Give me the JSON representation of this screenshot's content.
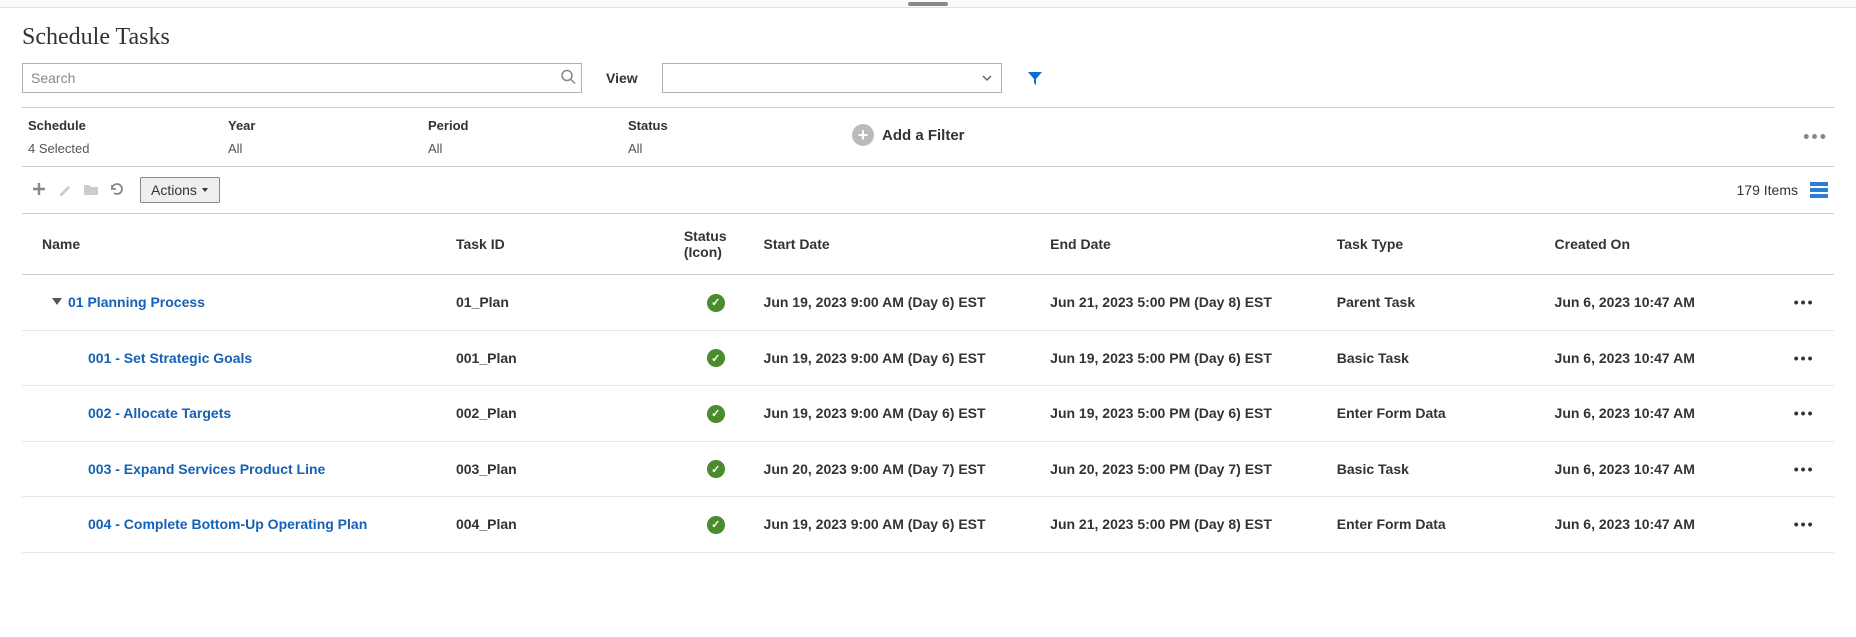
{
  "page_title": "Schedule Tasks",
  "search": {
    "placeholder": "Search"
  },
  "view_label": "View",
  "filters": [
    {
      "label": "Schedule",
      "value": "4 Selected"
    },
    {
      "label": "Year",
      "value": "All"
    },
    {
      "label": "Period",
      "value": "All"
    },
    {
      "label": "Status",
      "value": "All"
    }
  ],
  "add_filter_label": "Add a Filter",
  "toolbar": {
    "actions_label": "Actions",
    "item_count_label": "179 Items"
  },
  "columns": {
    "name": "Name",
    "task_id": "Task ID",
    "status_icon": "Status (Icon)",
    "start_date": "Start Date",
    "end_date": "End Date",
    "task_type": "Task Type",
    "created_on": "Created On"
  },
  "rows": [
    {
      "level": 1,
      "expandable": true,
      "name": "01 Planning Process",
      "task_id": "01_Plan",
      "status": "ok",
      "start_date": "Jun 19, 2023 9:00 AM (Day 6) EST",
      "end_date": "Jun 21, 2023 5:00 PM (Day 8) EST",
      "task_type": "Parent Task",
      "created_on": "Jun 6, 2023 10:47 AM"
    },
    {
      "level": 2,
      "expandable": false,
      "name": "001 - Set Strategic Goals",
      "task_id": "001_Plan",
      "status": "ok",
      "start_date": "Jun 19, 2023 9:00 AM (Day 6) EST",
      "end_date": "Jun 19, 2023 5:00 PM (Day 6) EST",
      "task_type": "Basic Task",
      "created_on": "Jun 6, 2023 10:47 AM"
    },
    {
      "level": 2,
      "expandable": false,
      "name": "002 - Allocate Targets",
      "task_id": "002_Plan",
      "status": "ok",
      "start_date": "Jun 19, 2023 9:00 AM (Day 6) EST",
      "end_date": "Jun 19, 2023 5:00 PM (Day 6) EST",
      "task_type": "Enter Form Data",
      "created_on": "Jun 6, 2023 10:47 AM"
    },
    {
      "level": 2,
      "expandable": false,
      "name": "003 - Expand Services Product Line",
      "task_id": "003_Plan",
      "status": "ok",
      "start_date": "Jun 20, 2023 9:00 AM (Day 7) EST",
      "end_date": "Jun 20, 2023 5:00 PM (Day 7) EST",
      "task_type": "Basic Task",
      "created_on": "Jun 6, 2023 10:47 AM"
    },
    {
      "level": 2,
      "expandable": false,
      "name": "004 - Complete Bottom-Up Operating Plan",
      "task_id": "004_Plan",
      "status": "ok",
      "start_date": "Jun 19, 2023 9:00 AM (Day 6) EST",
      "end_date": "Jun 21, 2023 5:00 PM (Day 8) EST",
      "task_type": "Enter Form Data",
      "created_on": "Jun 6, 2023 10:47 AM"
    }
  ]
}
